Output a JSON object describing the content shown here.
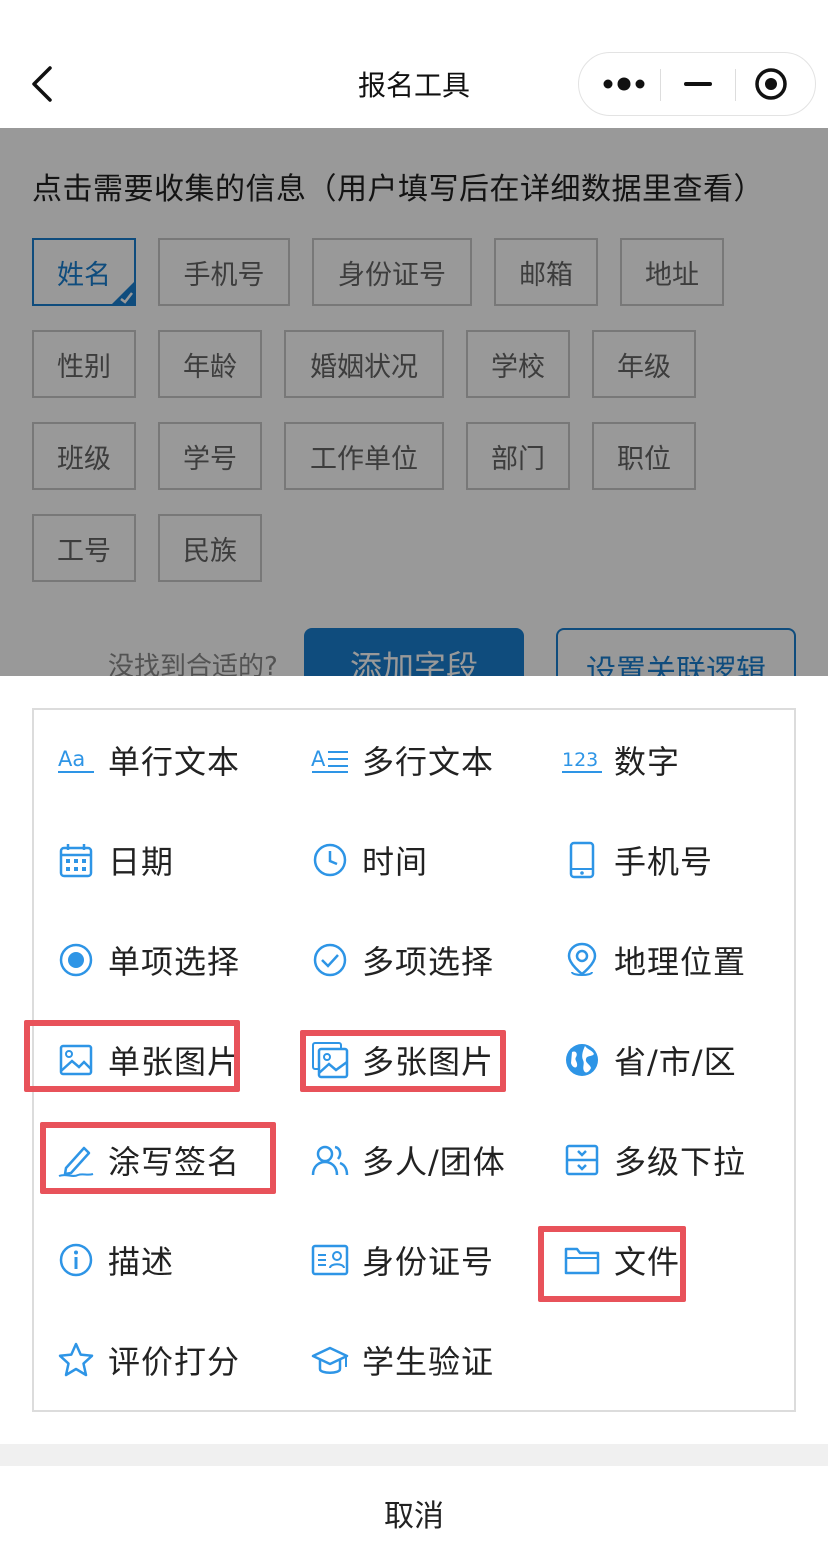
{
  "header": {
    "title": "报名工具"
  },
  "form": {
    "heading": "点击需要收集的信息（用户填写后在详细数据里查看）",
    "tags": [
      "姓名",
      "手机号",
      "身份证号",
      "邮箱",
      "地址",
      "性别",
      "年龄",
      "婚姻状况",
      "学校",
      "年级",
      "班级",
      "学号",
      "工作单位",
      "部门",
      "职位",
      "工号",
      "民族"
    ],
    "selected_tag": "姓名",
    "not_found": "没找到合适的?",
    "add_field": "添加字段",
    "logic": "设置关联逻辑"
  },
  "sheet": {
    "items": [
      {
        "label": "单行文本",
        "icon": "text-single-icon"
      },
      {
        "label": "多行文本",
        "icon": "text-multi-icon"
      },
      {
        "label": "数字",
        "icon": "number-icon"
      },
      {
        "label": "日期",
        "icon": "calendar-icon"
      },
      {
        "label": "时间",
        "icon": "clock-icon"
      },
      {
        "label": "手机号",
        "icon": "phone-icon"
      },
      {
        "label": "单项选择",
        "icon": "radio-icon"
      },
      {
        "label": "多项选择",
        "icon": "check-circle-icon"
      },
      {
        "label": "地理位置",
        "icon": "location-pin-icon"
      },
      {
        "label": "单张图片",
        "icon": "image-icon",
        "highlighted": true
      },
      {
        "label": "多张图片",
        "icon": "images-icon",
        "highlighted": true
      },
      {
        "label": "省/市/区",
        "icon": "globe-icon"
      },
      {
        "label": "涂写签名",
        "icon": "signature-pen-icon",
        "highlighted": true
      },
      {
        "label": "多人/团体",
        "icon": "group-icon"
      },
      {
        "label": "多级下拉",
        "icon": "cascade-dropdown-icon"
      },
      {
        "label": "描述",
        "icon": "info-icon"
      },
      {
        "label": "身份证号",
        "icon": "id-card-icon"
      },
      {
        "label": "文件",
        "icon": "folder-icon",
        "highlighted": true
      },
      {
        "label": "评价打分",
        "icon": "star-icon"
      },
      {
        "label": "学生验证",
        "icon": "graduation-cap-icon"
      }
    ],
    "cancel": "取消"
  },
  "colors": {
    "accent": "#1a7fd1",
    "icon": "#2e95e6",
    "highlight": "#e8525a",
    "mask": "rgba(0,0,0,0.4)"
  }
}
